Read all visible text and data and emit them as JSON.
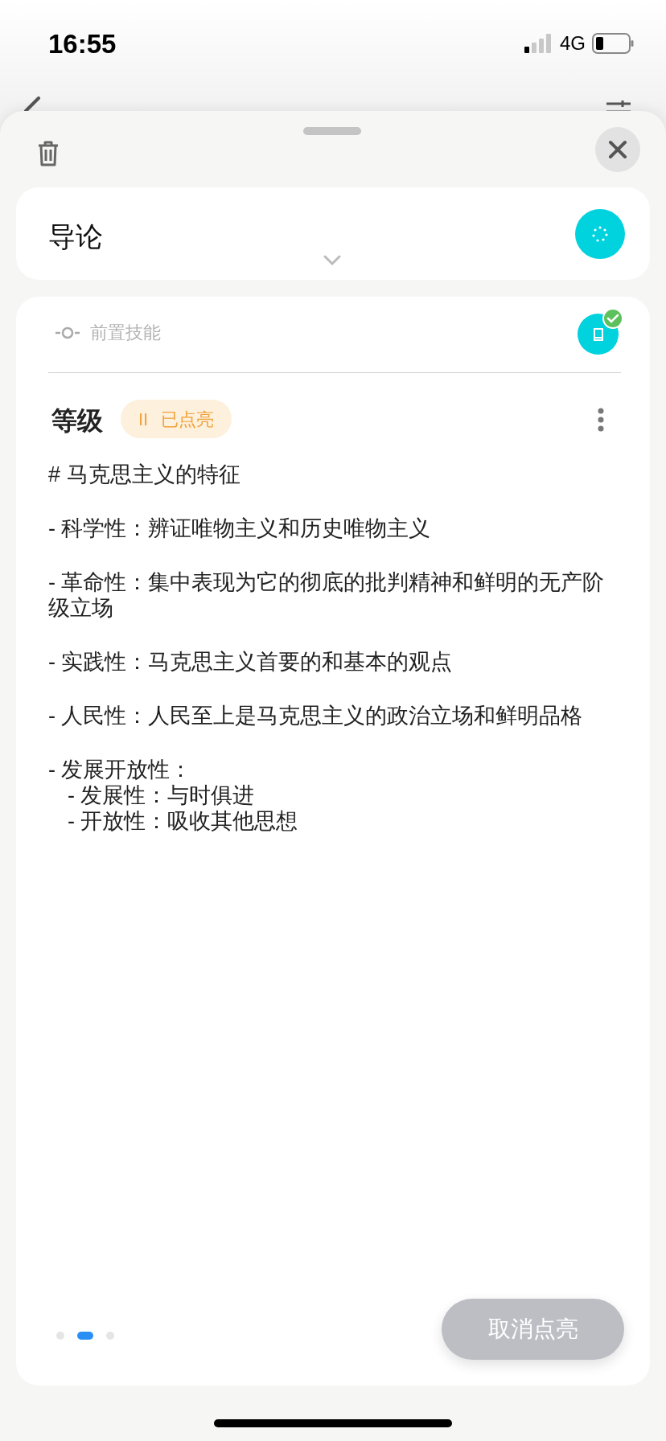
{
  "status_bar": {
    "time": "16:55",
    "network": "4G"
  },
  "sheet": {
    "section": {
      "title": "导论",
      "expanded": false
    },
    "prerequisite": {
      "label": "前置技能",
      "done": true
    },
    "level": {
      "label": "等级",
      "badge": {
        "icon": "II",
        "text": "已点亮"
      }
    },
    "content": [
      {
        "text": "# 马克思主义的特征"
      },
      {
        "text": "- 科学性：辨证唯物主义和历史唯物主义"
      },
      {
        "text": "- 革命性：集中表现为它的彻底的批判精神和鲜明的无产阶级立场"
      },
      {
        "text": "- 实践性：马克思主义首要的和基本的观点"
      },
      {
        "text": "- 人民性：人民至上是马克思主义的政治立场和鲜明品格"
      },
      {
        "text": "- 发展开放性：",
        "children": [
          {
            "text": "- 发展性：与时俱进"
          },
          {
            "text": "- 开放性：吸收其他思想"
          }
        ]
      }
    ],
    "pages": [
      {
        "selected": false
      },
      {
        "selected": true
      },
      {
        "selected": false
      }
    ],
    "action_button": "取消点亮"
  }
}
